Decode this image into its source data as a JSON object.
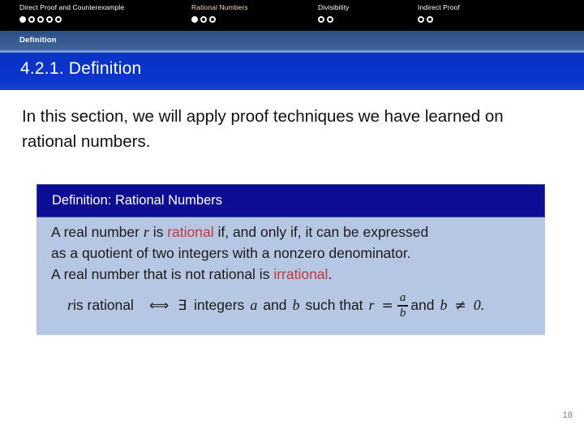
{
  "topnav": {
    "groups": [
      {
        "label": "Direct Proof and Counterexample",
        "active": false,
        "dots": [
          "filled",
          "hollow",
          "hollow",
          "hollow",
          "hollow"
        ]
      },
      {
        "label": "Rational Numbers",
        "active": true,
        "dots": [
          "filled",
          "hollow",
          "hollow"
        ]
      },
      {
        "label": "Divisibility",
        "active": false,
        "dots": [
          "hollow",
          "hollow"
        ]
      },
      {
        "label": "Indirect Proof",
        "active": false,
        "dots": [
          "hollow",
          "hollow"
        ]
      }
    ]
  },
  "section_bar": {
    "label": "Definition"
  },
  "title_bar": {
    "text": "4.2.1. Definition"
  },
  "intro": {
    "text": "In this section, we will apply proof techniques we have learned on rational numbers."
  },
  "definition_card": {
    "header": "Definition: Rational Numbers",
    "line1_a": "A real number ",
    "line1_var": "r",
    "line1_b": " is ",
    "line1_kw": "rational",
    "line1_c": " if, and only if, it can be expressed",
    "line2": "as a quotient of two integers with a nonzero denominator.",
    "line3_a": "A real number that is not rational is ",
    "line3_kw": "irrational",
    "line3_b": ".",
    "formula": {
      "lhs_var": "r",
      "lhs_text": " is rational",
      "iff": "⟺",
      "exists": "∃",
      "integers_text": "integers",
      "var_a": "a",
      "and_text": "and",
      "var_b": "b",
      "such_that": "such that",
      "eq_var": "r",
      "equals": "=",
      "frac_num": "a",
      "frac_den": "b",
      "tail_and": "and",
      "tail_var": "b",
      "neq": "≠",
      "tail_zero": "0."
    }
  },
  "page_number": "18",
  "colors": {
    "nav_background": "#000000",
    "nav_active_label": "#f0dfb8",
    "section_bar": "#36598f",
    "title_bar": "#0b35cb",
    "card_header": "#0c0c94",
    "card_body": "#b6c7e3",
    "keyword_red": "#c0393f",
    "page_number": "#808080"
  }
}
